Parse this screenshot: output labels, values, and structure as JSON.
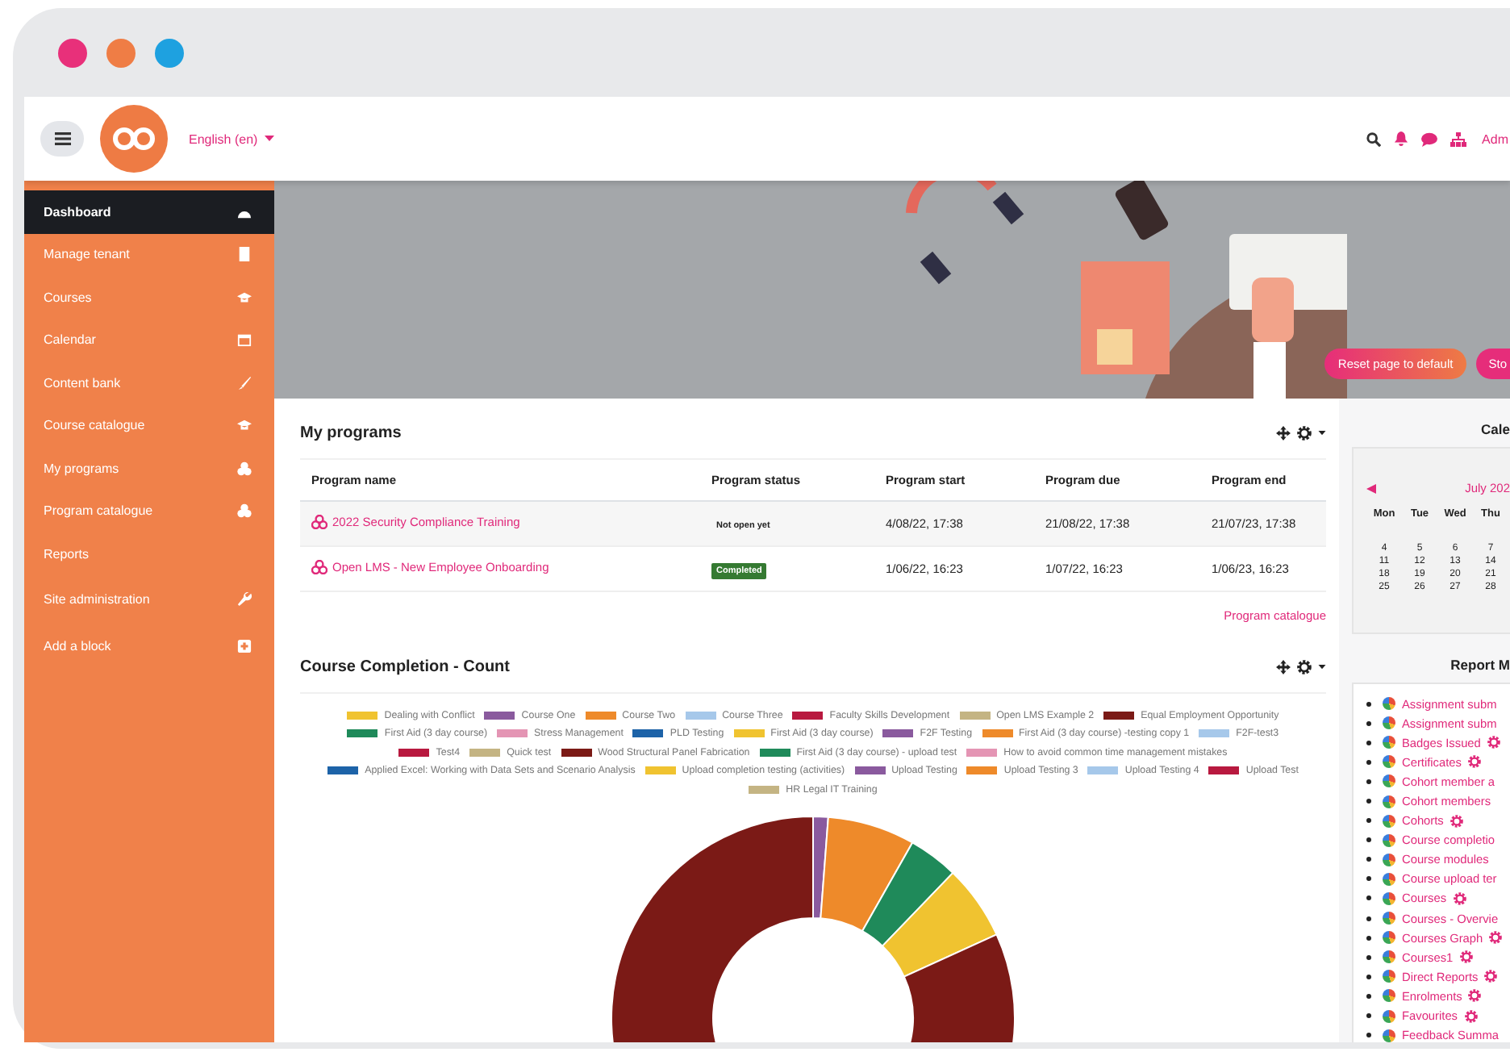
{
  "header": {
    "language": "English (en)",
    "user": "Adm"
  },
  "sidebar": {
    "items": [
      {
        "label": "Dashboard",
        "selected": true
      },
      {
        "label": "Manage tenant",
        "selected": false
      },
      {
        "label": "Courses",
        "selected": false
      },
      {
        "label": "Calendar",
        "selected": false
      },
      {
        "label": "Content bank",
        "selected": false
      },
      {
        "label": "Course catalogue",
        "selected": false
      },
      {
        "label": "My programs",
        "selected": false
      },
      {
        "label": "Program catalogue",
        "selected": false
      },
      {
        "label": "Reports",
        "selected": false
      },
      {
        "label": "Site administration",
        "selected": false
      },
      {
        "label": "Add a block",
        "selected": false
      }
    ]
  },
  "banner": {
    "buttons": [
      "Reset page to default",
      "Sto"
    ]
  },
  "my_programs": {
    "title": "My programs",
    "columns": [
      "Program name",
      "Program status",
      "Program start",
      "Program due",
      "Program end"
    ],
    "rows": [
      {
        "name": "2022 Security Compliance Training",
        "status": {
          "label": "Not open yet",
          "kind": "plain"
        },
        "start": "4/08/22, 17:38",
        "due": "21/08/22, 17:38",
        "end": "21/07/23, 17:38"
      },
      {
        "name": "Open LMS - New Employee Onboarding",
        "status": {
          "label": "Completed",
          "kind": "success"
        },
        "start": "1/06/22, 16:23",
        "due": "1/07/22, 16:23",
        "end": "1/06/23, 16:23"
      }
    ],
    "link": "Program catalogue"
  },
  "course_completion": {
    "title": "Course Completion - Count",
    "legend": [
      {
        "label": "Dealing with Conflict",
        "color": "#f0c330"
      },
      {
        "label": "Course One",
        "color": "#8a5a9e"
      },
      {
        "label": "Course Two",
        "color": "#ee8a2a"
      },
      {
        "label": "Course Three",
        "color": "#a6c8ea"
      },
      {
        "label": "Faculty Skills Development",
        "color": "#b8193f"
      },
      {
        "label": "Open LMS Example 2",
        "color": "#c4b483"
      },
      {
        "label": "Equal Employment Opportunity",
        "color": "#7b1a16"
      },
      {
        "label": "First Aid (3 day course)",
        "color": "#1f8a5a"
      },
      {
        "label": "Stress Management",
        "color": "#e495b4"
      },
      {
        "label": "PLD Testing",
        "color": "#1d63a8"
      },
      {
        "label": "First Aid (3 day course)",
        "color": "#f0c330"
      },
      {
        "label": "F2F Testing",
        "color": "#8a5a9e"
      },
      {
        "label": "First Aid (3 day course) -testing copy 1",
        "color": "#ee8a2a"
      },
      {
        "label": "F2F-test3",
        "color": "#a6c8ea"
      },
      {
        "label": "Test4",
        "color": "#b8193f"
      },
      {
        "label": "Quick test",
        "color": "#c4b483"
      },
      {
        "label": "Wood Structural Panel Fabrication",
        "color": "#7b1a16"
      },
      {
        "label": "First Aid (3 day course) - upload test",
        "color": "#1f8a5a"
      },
      {
        "label": "How to avoid common time management mistakes",
        "color": "#e495b4"
      },
      {
        "label": "Applied Excel: Working with Data Sets and Scenario Analysis",
        "color": "#1d63a8"
      },
      {
        "label": "Upload completion testing (activities)",
        "color": "#f0c330"
      },
      {
        "label": "Upload Testing",
        "color": "#8a5a9e"
      },
      {
        "label": "Upload Testing 3",
        "color": "#ee8a2a"
      },
      {
        "label": "Upload Testing 4",
        "color": "#a6c8ea"
      },
      {
        "label": "Upload Test",
        "color": "#b8193f"
      },
      {
        "label": "HR Legal IT Training",
        "color": "#c4b483"
      }
    ]
  },
  "calendar": {
    "title": "Cale",
    "month": "July 202",
    "weekdays": [
      "Mon",
      "Tue",
      "Wed",
      "Thu"
    ],
    "weeks": [
      [
        "4",
        "5",
        "6",
        "7"
      ],
      [
        "11",
        "12",
        "13",
        "14"
      ],
      [
        "18",
        "19",
        "20",
        "21"
      ],
      [
        "25",
        "26",
        "27",
        "28"
      ]
    ]
  },
  "report_menu": {
    "title": "Report M",
    "items": [
      {
        "label": "Assignment subm",
        "gear": false
      },
      {
        "label": "Assignment subm",
        "gear": false
      },
      {
        "label": "Badges Issued",
        "gear": true
      },
      {
        "label": "Certificates",
        "gear": true
      },
      {
        "label": "Cohort member a",
        "gear": false
      },
      {
        "label": "Cohort members",
        "gear": false
      },
      {
        "label": "Cohorts",
        "gear": true
      },
      {
        "label": "Course completio",
        "gear": false
      },
      {
        "label": "Course modules",
        "gear": false
      },
      {
        "label": "Course upload ter",
        "gear": false
      },
      {
        "label": "Courses",
        "gear": true
      },
      {
        "label": "Courses - Overvie",
        "gear": false
      },
      {
        "label": "Courses Graph",
        "gear": true
      },
      {
        "label": "Courses1",
        "gear": true
      },
      {
        "label": "Direct Reports",
        "gear": true
      },
      {
        "label": "Enrolments",
        "gear": true
      },
      {
        "label": "Favourites",
        "gear": true
      },
      {
        "label": "Feedback Summa",
        "gear": false
      }
    ]
  }
}
